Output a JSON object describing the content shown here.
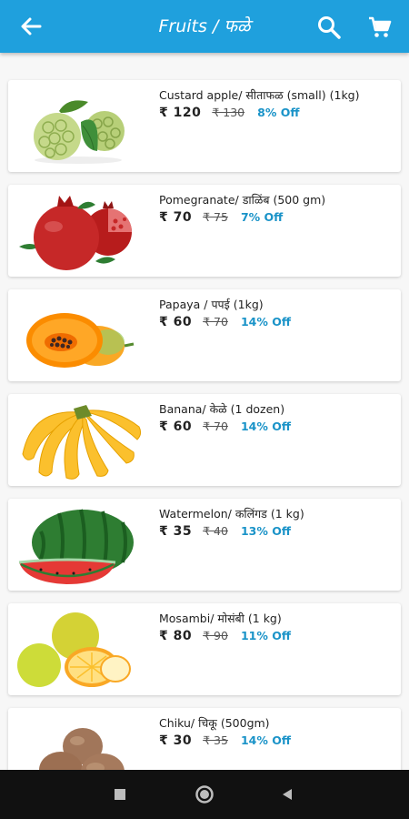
{
  "header": {
    "title": "Fruits / फळे"
  },
  "products": [
    {
      "name": "Custard apple/ सीताफळ (small) (1kg)",
      "price": "₹ 120",
      "mrp": "₹ 130",
      "off": "8% Off"
    },
    {
      "name": "Pomegranate/ डाळिंब (500 gm)",
      "price": "₹ 70",
      "mrp": "₹ 75",
      "off": "7% Off"
    },
    {
      "name": "Papaya / पपई (1kg)",
      "price": "₹ 60",
      "mrp": "₹ 70",
      "off": "14% Off"
    },
    {
      "name": "Banana/ केळे (1 dozen)",
      "price": "₹ 60",
      "mrp": "₹ 70",
      "off": "14% Off"
    },
    {
      "name": "Watermelon/ कलिंगड (1 kg)",
      "price": "₹ 35",
      "mrp": "₹ 40",
      "off": "13% Off"
    },
    {
      "name": "Mosambi/ मोसंबी (1 kg)",
      "price": "₹ 80",
      "mrp": "₹ 90",
      "off": "11% Off"
    },
    {
      "name": "Chiku/ चिकू (500gm)",
      "price": "₹ 30",
      "mrp": "₹ 35",
      "off": "14% Off"
    }
  ],
  "colors": {
    "appbar": "#1fa0dd",
    "discount": "#1a93c8"
  }
}
